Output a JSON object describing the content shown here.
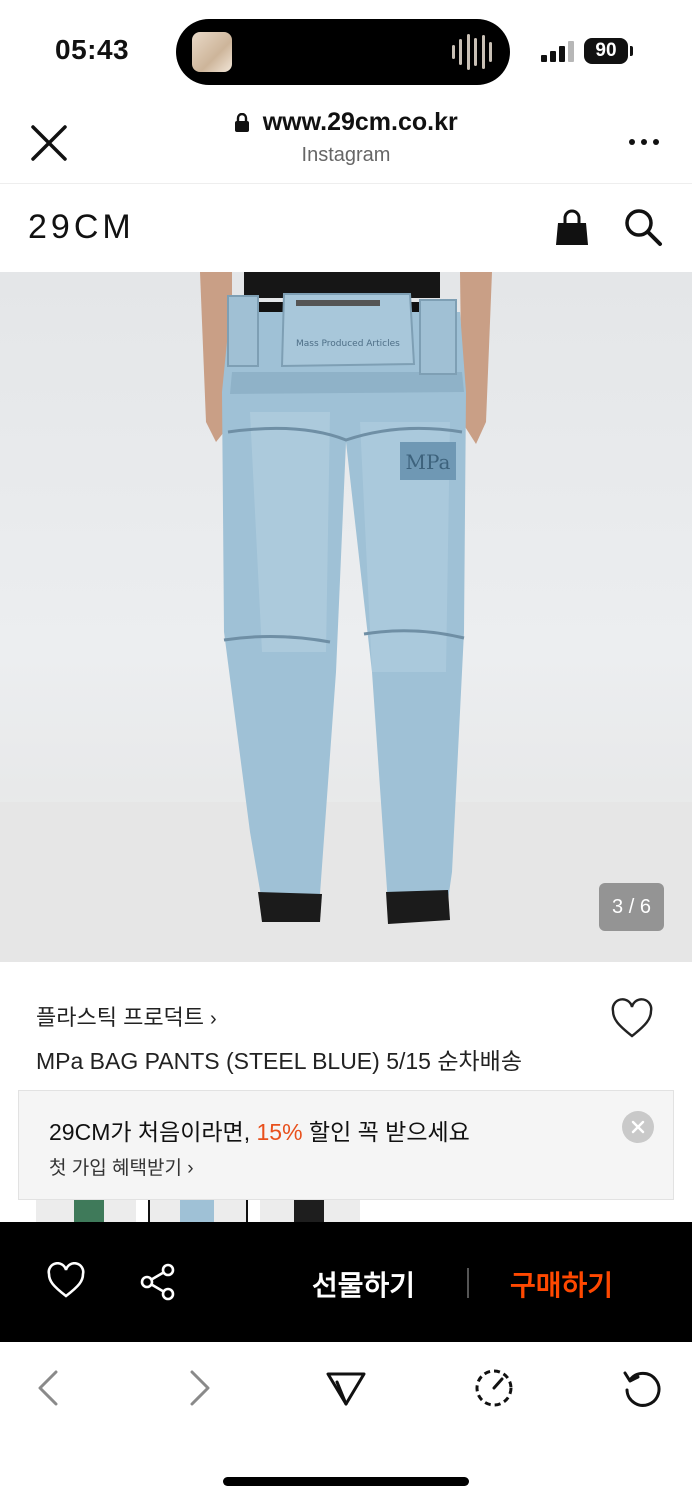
{
  "status_bar": {
    "time": "05:43",
    "battery": "90"
  },
  "browser": {
    "url": "www.29cm.co.kr",
    "source": "Instagram"
  },
  "site": {
    "logo": "29CM"
  },
  "product": {
    "image_counter": "3 / 6",
    "brand": "플라스틱 프로덕트",
    "brand_chevron": "›",
    "name": "MPa BAG PANTS (STEEL BLUE) 5/15 순차배송",
    "image_texts": {
      "patch": "MPa",
      "waistband_print": "Mass Produced Articles"
    }
  },
  "banner": {
    "line_prefix": "29CM가 처음이라면, ",
    "discount": "15%",
    "line_suffix": " 할인 꼭 받으세요",
    "link": "첫 가입 혜택받기 ›"
  },
  "action_bar": {
    "gift_label": "선물하기",
    "buy_label": "구매하기"
  },
  "colors": {
    "accent_orange": "#ff4800",
    "discount_orange": "#e8501c",
    "action_bar_bg": "#000000"
  },
  "icons": {
    "close": "close-icon",
    "lock": "lock-icon",
    "more": "more-icon",
    "bag": "shopping-bag-icon",
    "search": "search-icon",
    "heart": "heart-icon",
    "share": "share-icon",
    "back": "chevron-left-icon",
    "forward": "chevron-right-icon",
    "send": "send-icon",
    "speed": "speedometer-icon",
    "reload": "reload-icon"
  }
}
